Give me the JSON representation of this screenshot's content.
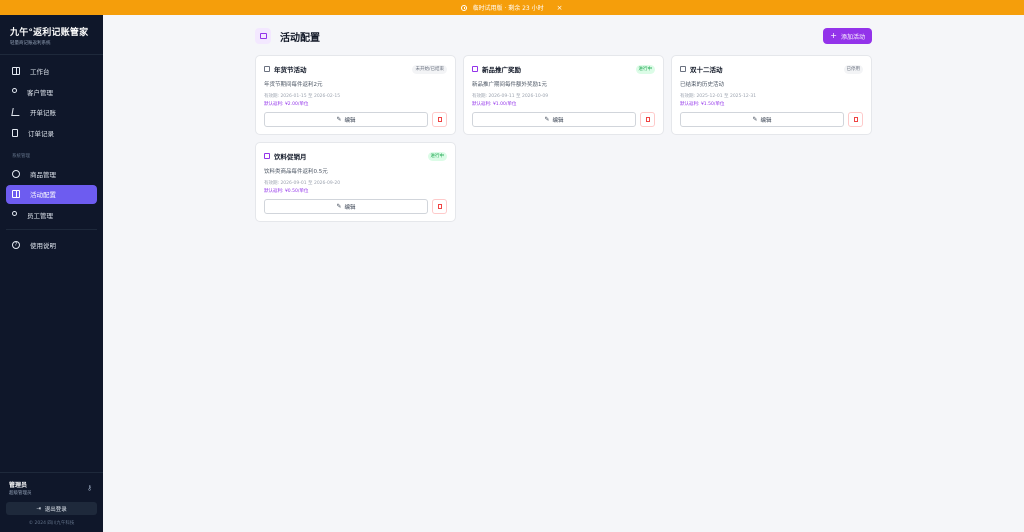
{
  "banner": {
    "text": "临时试用版 · 剩余 23 小时",
    "close": "×"
  },
  "sidebar": {
    "brand_title": "九午°返利记账管家",
    "brand_sub": "轻量商记账返利系统",
    "items": [
      {
        "label": "工作台",
        "icon": "dashboard-icon"
      },
      {
        "label": "客户管理",
        "icon": "user-icon"
      },
      {
        "label": "开单记账",
        "icon": "cart-icon"
      },
      {
        "label": "订单记录",
        "icon": "document-icon"
      }
    ],
    "section_label": "系统管理",
    "system_items": [
      {
        "label": "商品管理",
        "icon": "box-icon"
      },
      {
        "label": "活动配置",
        "icon": "gift-icon",
        "active": true
      },
      {
        "label": "员工管理",
        "icon": "users-icon"
      }
    ],
    "help_label": "使用说明",
    "user_name": "管理员",
    "user_role": "超级管理员",
    "logout_label": "退出登录",
    "copyright": "© 2024 四川九午科技"
  },
  "page": {
    "title": "活动配置",
    "add_label": "添加活动"
  },
  "cards": [
    {
      "title": "年货节活动",
      "status": "未开始/已结束",
      "status_type": "gray",
      "desc": "年货节期间每件返利2元",
      "period": "有效期: 2026-01-15 至 2026-02-15",
      "rebate": "默认返利: ¥2.00/单位",
      "edit": "编辑"
    },
    {
      "title": "新品推广奖励",
      "status": "进行中",
      "status_type": "green",
      "desc": "新品推广期间每件额外奖励1元",
      "period": "有效期: 2026-09-11 至 2026-10-09",
      "rebate": "默认返利: ¥1.00/单位",
      "edit": "编辑"
    },
    {
      "title": "双十二活动",
      "status": "已停用",
      "status_type": "gray",
      "desc": "已结束的历史活动",
      "period": "有效期: 2025-12-01 至 2025-12-31",
      "rebate": "默认返利: ¥1.50/单位",
      "edit": "编辑"
    },
    {
      "title": "饮料促销月",
      "status": "进行中",
      "status_type": "green",
      "desc": "饮料类商品每件返利0.5元",
      "period": "有效期: 2026-09-01 至 2026-09-20",
      "rebate": "默认返利: ¥0.50/单位",
      "edit": "编辑"
    }
  ]
}
